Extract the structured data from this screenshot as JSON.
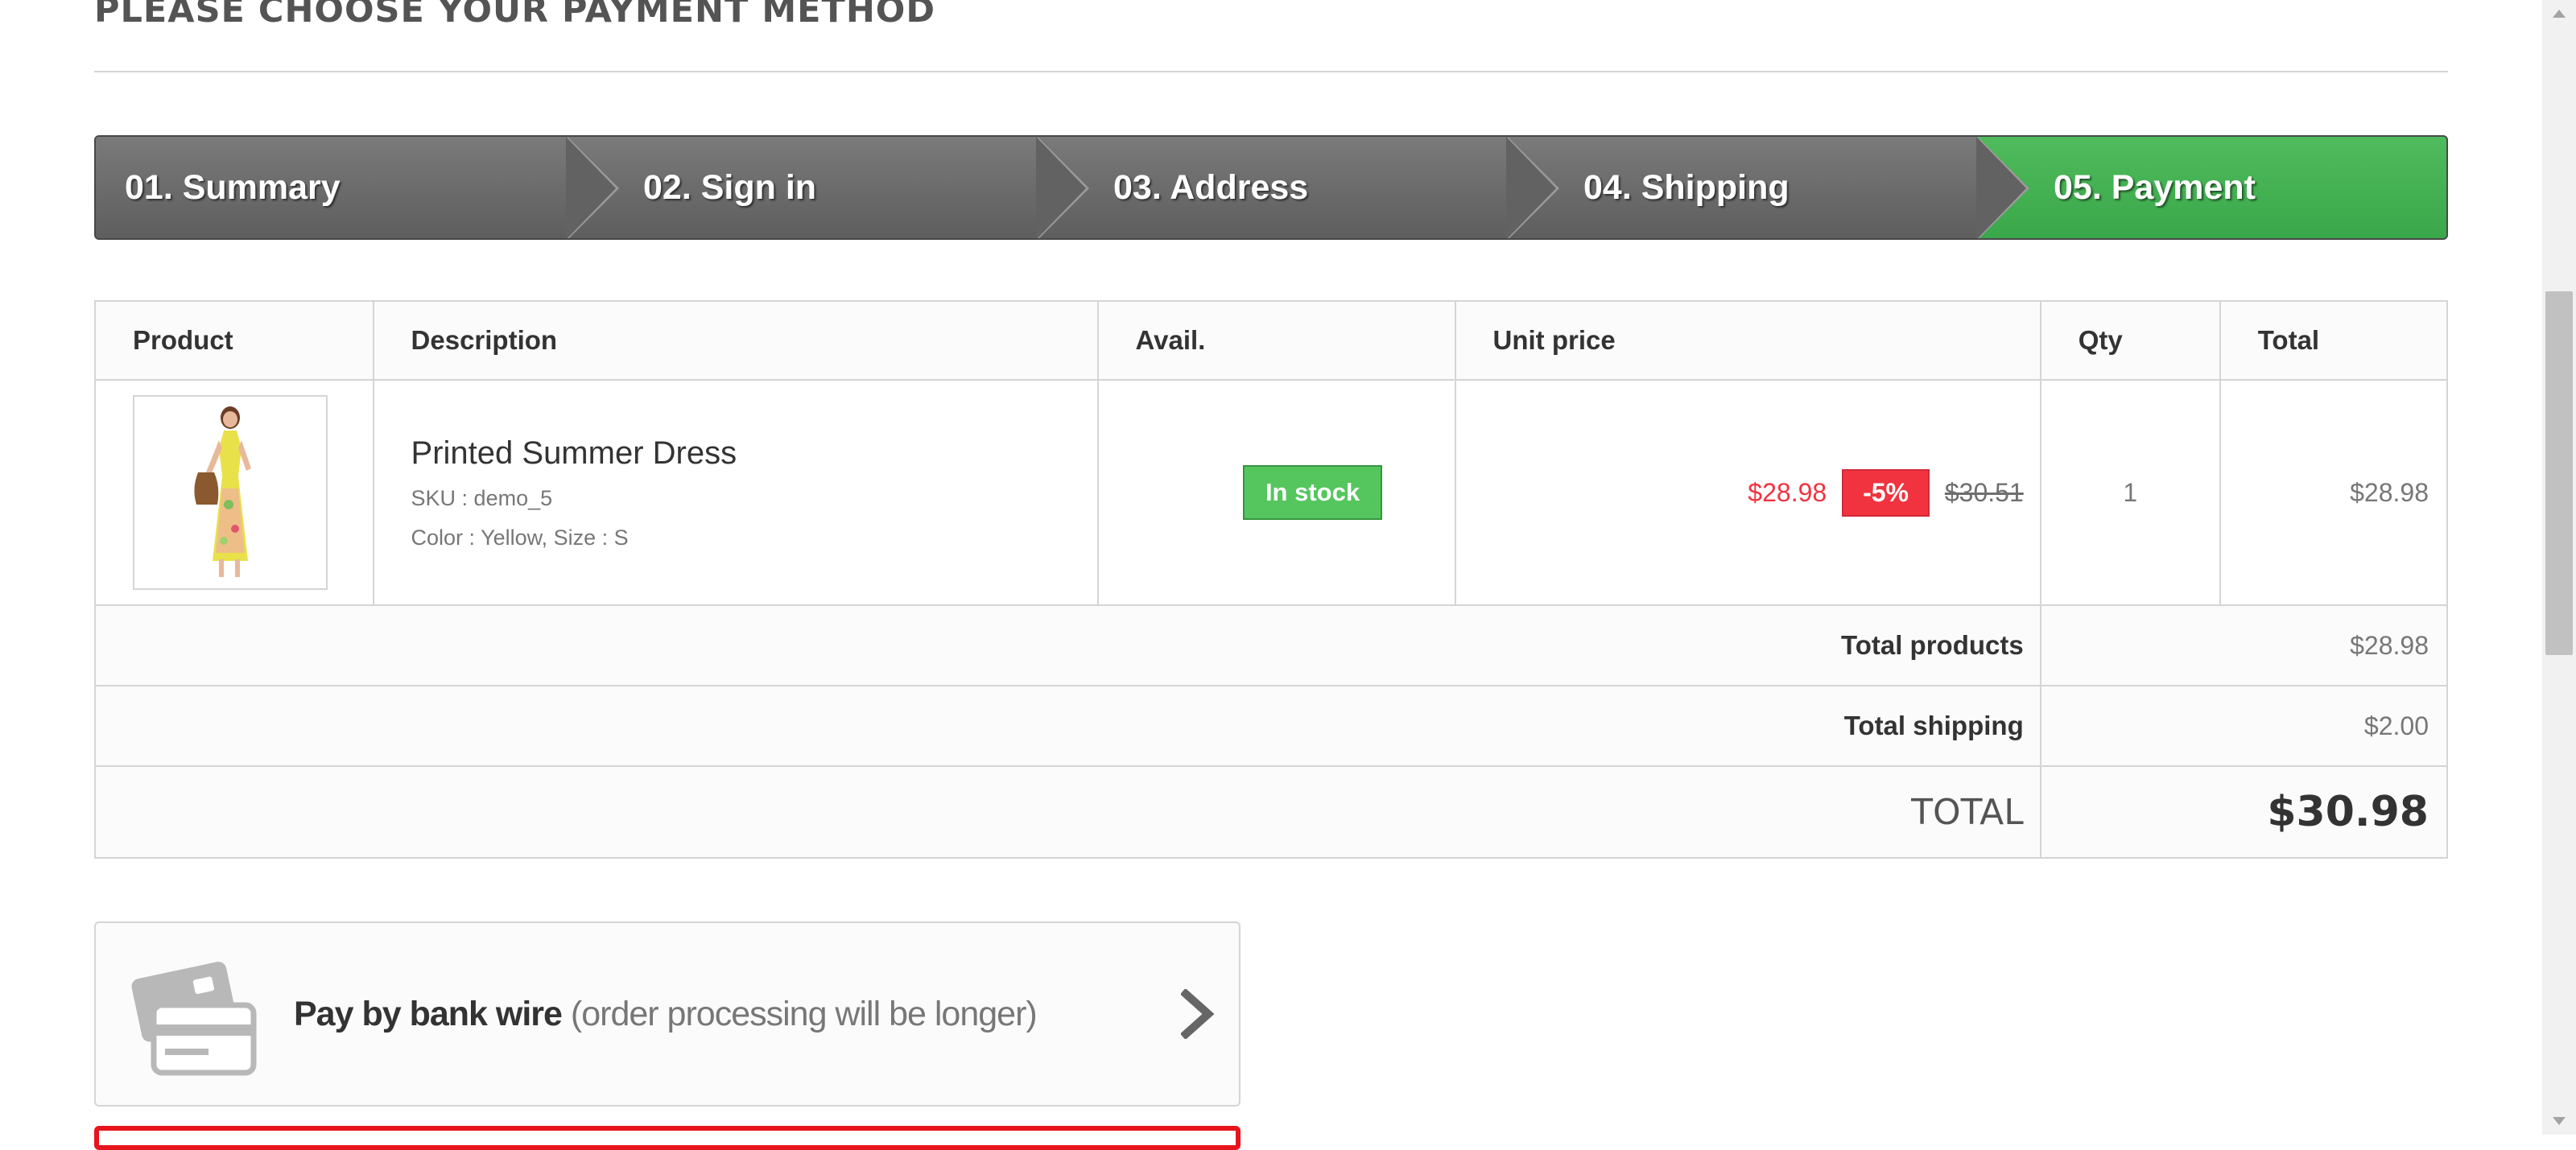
{
  "page": {
    "heading": "PLEASE CHOOSE YOUR PAYMENT METHOD"
  },
  "steps": [
    {
      "label": "01. Summary",
      "active": false
    },
    {
      "label": "02. Sign in",
      "active": false
    },
    {
      "label": "03. Address",
      "active": false
    },
    {
      "label": "04. Shipping",
      "active": false
    },
    {
      "label": "05. Payment",
      "active": true
    }
  ],
  "cart": {
    "headers": {
      "product": "Product",
      "description": "Description",
      "avail": "Avail.",
      "unit_price": "Unit price",
      "qty": "Qty",
      "total": "Total"
    },
    "items": [
      {
        "image_icon": "dress-product-image",
        "name": "Printed Summer Dress",
        "sku": "SKU : demo_5",
        "attributes": "Color : Yellow, Size : S",
        "availability": "In stock",
        "price": "$28.98",
        "reduction": "-5%",
        "old_price": "$30.51",
        "qty": "1",
        "total": "$28.98"
      }
    ],
    "total_products_label": "Total products",
    "total_products": "$28.98",
    "total_shipping_label": "Total shipping",
    "total_shipping": "$2.00",
    "grand_total_label": "TOTAL",
    "grand_total": "$30.98"
  },
  "payment": {
    "option_icon": "credit-card-icon",
    "option_strong": "Pay by bank wire",
    "option_note": "(order processing will be longer)"
  },
  "colors": {
    "active_step": "#46b450",
    "step": "#6b6b6b",
    "price_red": "#f13340",
    "in_stock_green": "#55c65e",
    "next_option_border": "#e8141c"
  }
}
